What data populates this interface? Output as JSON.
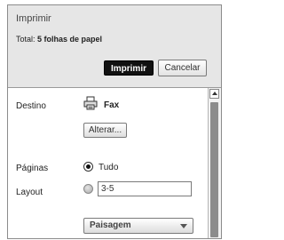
{
  "dialog": {
    "title": "Imprimir",
    "total_label": "Total:",
    "total_value": "5 folhas de papel",
    "print_button": "Imprimir",
    "cancel_button": "Cancelar"
  },
  "destination": {
    "label": "Destino",
    "printer_icon": "printer-icon",
    "printer_name": "Fax",
    "change_button": "Alterar..."
  },
  "pages": {
    "label": "Páginas",
    "all_option": "Tudo",
    "all_selected": true,
    "range_value": "3-5"
  },
  "layout": {
    "label": "Layout",
    "orientation": "Paisagem"
  },
  "colors": {
    "header_bg": "#e6e6e6",
    "primary_button_bg": "#111111",
    "scroll_thumb": "#8c8c8c"
  }
}
